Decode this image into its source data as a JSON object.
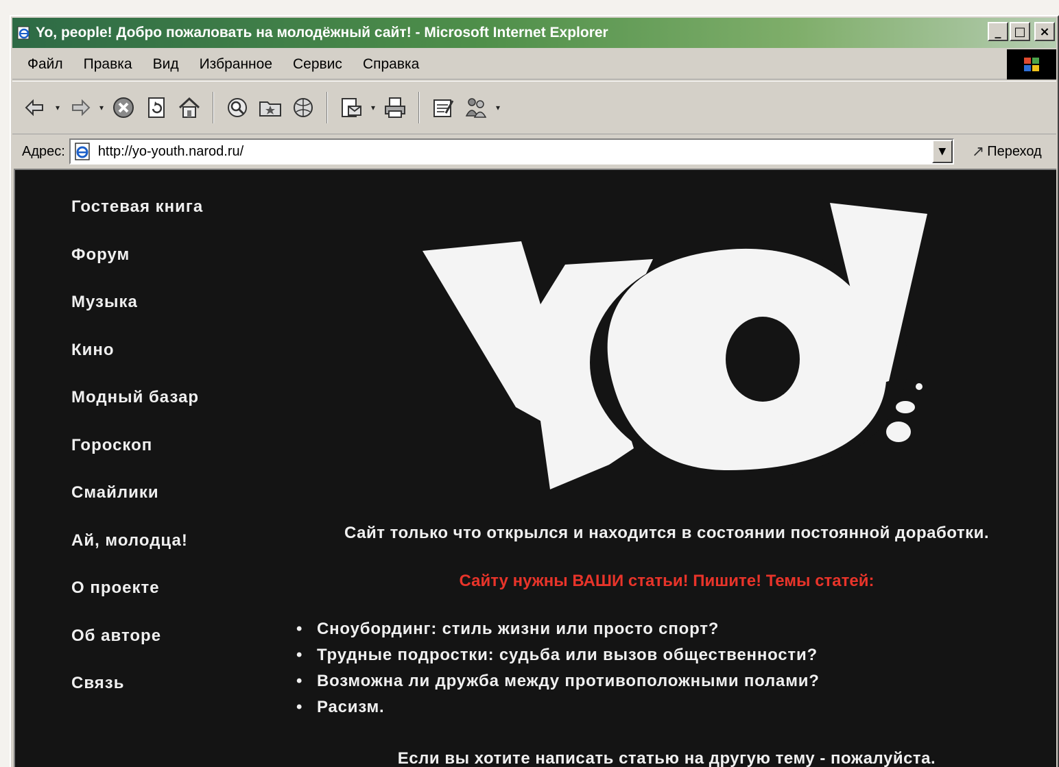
{
  "window": {
    "title": "Yo, people! Добро пожаловать на молодёжный сайт! - Microsoft Internet Explorer",
    "buttons": {
      "minimize": "_",
      "maximize": "□",
      "close": "×"
    }
  },
  "menubar": {
    "items": [
      "Файл",
      "Правка",
      "Вид",
      "Избранное",
      "Сервис",
      "Справка"
    ]
  },
  "toolbar": {
    "icons": [
      "back-icon",
      "forward-icon",
      "stop-icon",
      "refresh-icon",
      "home-icon",
      "search-icon",
      "favorites-icon",
      "history-icon",
      "mail-icon",
      "print-icon",
      "edit-icon",
      "messenger-icon"
    ]
  },
  "address": {
    "label": "Адрес:",
    "url": "http://yo-youth.narod.ru/",
    "go_label": "Переход"
  },
  "page": {
    "nav": [
      "Гостевая книга",
      "Форум",
      "Музыка",
      "Кино",
      "Модный базар",
      "Гороскоп",
      "Смайлики",
      "Ай, молодца!",
      "О проекте",
      "Об авторе",
      "Связь"
    ],
    "logo_text": "YO!",
    "status": "Сайт только что открылся и находится в состоянии постоянной доработки.",
    "callout": "Сайту нужны ВАШИ статьи! Пишите! Темы статей:",
    "topics": [
      "Сноубординг: стиль жизни или просто спорт?",
      "Трудные подростки: судьба или вызов общественности?",
      "Возможна ли дружба между противоположными полами?",
      "Расизм."
    ],
    "footer_note": "Если вы хотите написать статью на другую тему - пожалуйста."
  },
  "colors": {
    "page_background": "#141414",
    "text": "#f0f0f0",
    "callout": "#e8342a",
    "titlebar_start": "#2d6a45"
  }
}
